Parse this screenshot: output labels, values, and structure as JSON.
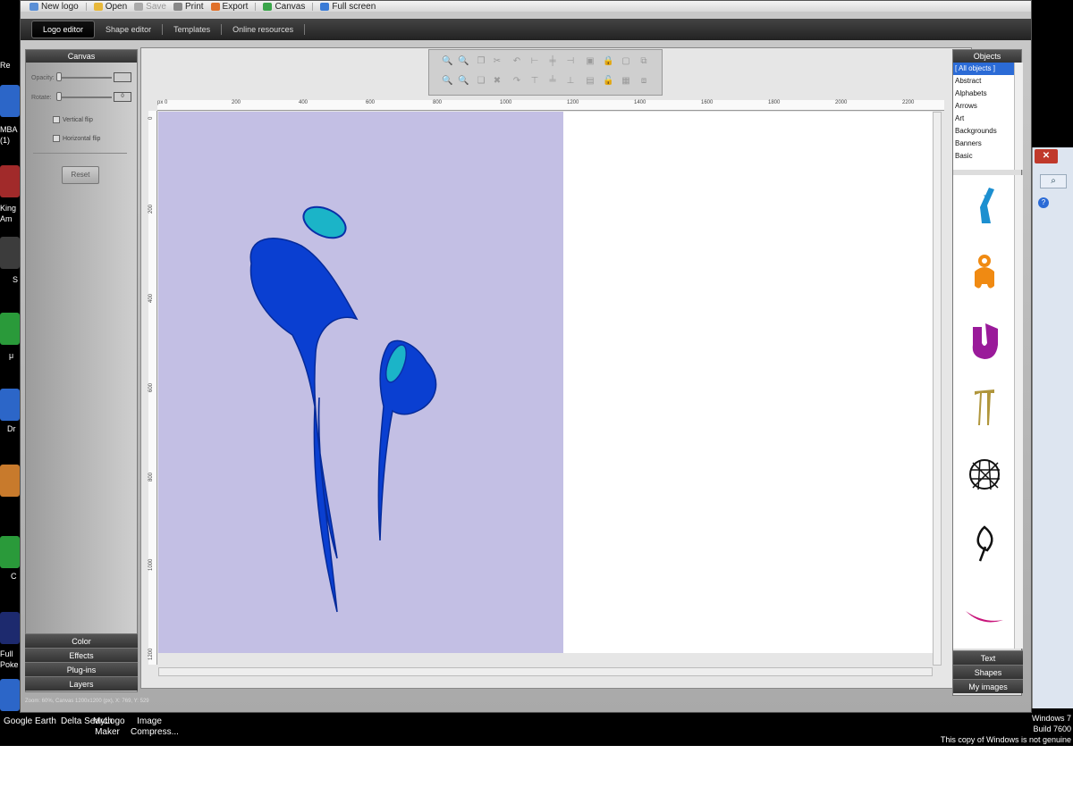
{
  "menubar": {
    "items": [
      {
        "label": "New logo",
        "enabled": true
      },
      {
        "label": "Open",
        "enabled": true
      },
      {
        "label": "Save",
        "enabled": false
      },
      {
        "label": "Print",
        "enabled": true
      },
      {
        "label": "Export",
        "enabled": true
      },
      {
        "label": "Canvas",
        "enabled": true
      },
      {
        "label": "Full screen",
        "enabled": true
      }
    ]
  },
  "tabs": [
    "Logo editor",
    "Shape editor",
    "Templates",
    "Online resources"
  ],
  "left_panel": {
    "title": "Canvas",
    "opacity_label": "Opacity:",
    "rotate_label": "Rotate:",
    "rotate_value": "0",
    "vertical_flip": "Vertical flip",
    "horizontal_flip": "Horizontal flip",
    "reset": "Reset",
    "accordion": [
      "Color",
      "Effects",
      "Plug-ins",
      "Layers"
    ]
  },
  "ruler": {
    "unit": "px",
    "top_labels": [
      "0",
      "200",
      "400",
      "600",
      "800",
      "1000",
      "1200",
      "1400",
      "1600",
      "1800",
      "2000",
      "2200"
    ],
    "left_labels": [
      "0",
      "200",
      "400",
      "600",
      "800",
      "1000",
      "1200"
    ]
  },
  "status": "Zoom: 60%, Canvas 1200x1200 (px), X: 769, Y: 529",
  "right_panel": {
    "title": "Objects",
    "categories": [
      "[ All objects ]",
      "Abstract",
      "Alphabets",
      "Arrows",
      "Art",
      "Backgrounds",
      "Banners",
      "Basic"
    ],
    "tabs": [
      "Text",
      "Shapes",
      "My images"
    ],
    "shapes": [
      "blue-figure-shape",
      "orange-lock-shape",
      "purple-u-shape",
      "gold-column-shape",
      "black-net-ball-shape",
      "black-leaf-shape",
      "magenta-swoosh-shape"
    ]
  },
  "taskbar": {
    "apps": [
      "Google Earth",
      "Delta Search",
      "MyLogo Maker",
      "Image Compress..."
    ],
    "windows_lines": [
      "Windows 7",
      "Build 7600",
      "This copy of Windows is not genuine"
    ]
  },
  "desktop_labels": [
    "Re",
    "MBA",
    "(1)",
    "King",
    "Am",
    "S",
    "μ",
    "Dr",
    "C",
    "Full",
    "Poke"
  ],
  "colors": {
    "artboard": "#c3bfe4",
    "figure_blue": "#0a3fd1",
    "figure_teal": "#1bb4c8",
    "selection_blue": "#2b6bd6"
  }
}
